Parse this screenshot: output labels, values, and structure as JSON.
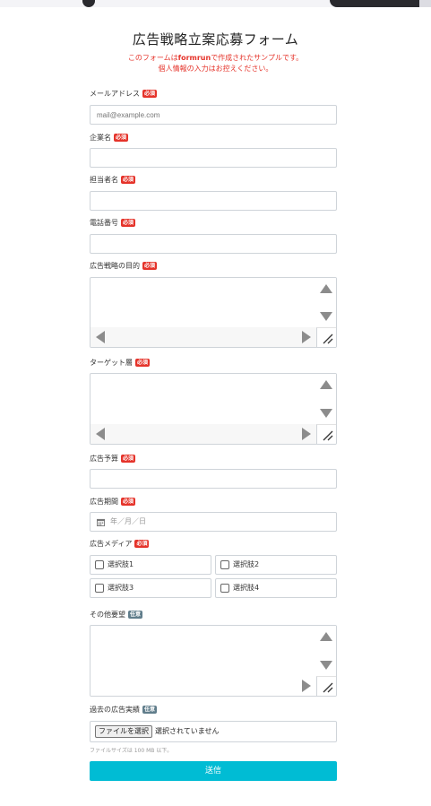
{
  "form": {
    "title": "広告戦略立案応募フォーム",
    "notice": {
      "line1_before": "このフォームは",
      "line1_brand": "formrun",
      "line1_after": "で作成されたサンプルです。",
      "line2": "個人情報の入力はお控えください。"
    },
    "badges": {
      "required": "必須",
      "optional": "任意"
    },
    "fields": {
      "email": {
        "label": "メールアドレス",
        "placeholder": "mail@example.com",
        "value": ""
      },
      "company": {
        "label": "企業名",
        "value": ""
      },
      "person": {
        "label": "担当者名",
        "value": ""
      },
      "phone": {
        "label": "電話番号",
        "value": ""
      },
      "purpose": {
        "label": "広告戦略の目的",
        "value": ""
      },
      "target": {
        "label": "ターゲット層",
        "value": ""
      },
      "budget": {
        "label": "広告予算",
        "value": ""
      },
      "period": {
        "label": "広告期間",
        "placeholder": "年／月／日"
      },
      "media": {
        "label": "広告メディア",
        "options": [
          "選択肢1",
          "選択肢2",
          "選択肢3",
          "選択肢4"
        ]
      },
      "other": {
        "label": "その他要望",
        "value": ""
      },
      "past": {
        "label": "過去の広告実績",
        "button": "ファイルを選択",
        "status": "選択されていません",
        "hint": "ファイルサイズは 100 MB 以下。"
      }
    },
    "submit_label": "送信"
  },
  "colors": {
    "required_badge": "#e5332a",
    "optional_badge": "#607d8b",
    "submit": "#00bcd4",
    "notice": "#e5332a"
  }
}
